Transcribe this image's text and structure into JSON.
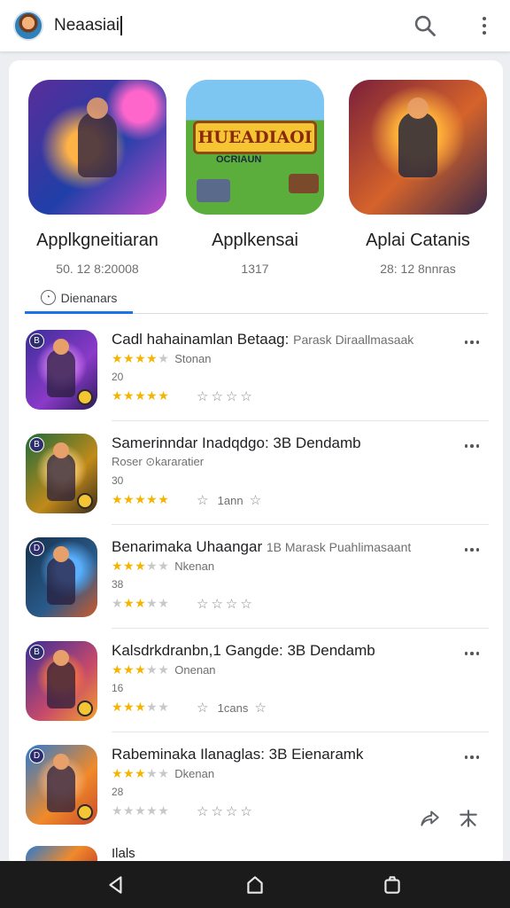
{
  "search": {
    "query": "Neaasiai"
  },
  "featured": [
    {
      "name": "Applkgneitiaran",
      "meta": "50. 12 8:20008"
    },
    {
      "name": "Applkensai",
      "meta": "1317",
      "art_text": "HUEADIAOI",
      "art_subtext": "OCRIAUN"
    },
    {
      "name": "Aplai Catanis",
      "meta": "28: 12 8nnras"
    }
  ],
  "tab": {
    "label": "Dienanars"
  },
  "list": [
    {
      "title": "Cadl hahainamlan Betaag:",
      "subtitle": "Parask Diraallmasaak",
      "rating_label": "Stonan",
      "count": "20",
      "stars": 4.5,
      "extra_label": "",
      "badge": "B"
    },
    {
      "title": "Samerinndar Inadqdgo: 3B Dendamb",
      "subtitle": "",
      "rating_label": "Roser ⊙kararatier",
      "count": "30",
      "stars": 4.5,
      "extra_label": "1ann",
      "badge": "B"
    },
    {
      "title": "Benarimaka Uhaangar",
      "subtitle": "1B Marask Puahlimasaant",
      "rating_label": "Nkenan",
      "count": "38",
      "stars": 3.5,
      "extra_label": "",
      "badge": "D"
    },
    {
      "title": "Kalsdrkdranbn,1 Gangde: 3B Dendamb",
      "subtitle": "",
      "rating_label": "Onenan",
      "count": "16",
      "stars": 3.5,
      "extra_label": "1cans",
      "badge": "B"
    },
    {
      "title": "Rabeminaka Ilanaglas: 3B Eienaramk",
      "subtitle": "",
      "rating_label": "Dkenan",
      "count": "28",
      "stars": 3,
      "extra_label": "",
      "badge": "D"
    }
  ],
  "peek_item": {
    "title": "Ilals"
  },
  "icons": {
    "avatar": "avatar-icon",
    "search": "search-icon",
    "more": "more-vert-icon",
    "tab": "clock-icon",
    "share": "share-icon",
    "pin": "pin-icon",
    "back": "back-icon",
    "home": "home-icon",
    "recents": "recents-icon"
  },
  "colors": {
    "accent": "#1a73e8",
    "star": "#f4b400",
    "navbar": "#1b1b1b"
  }
}
